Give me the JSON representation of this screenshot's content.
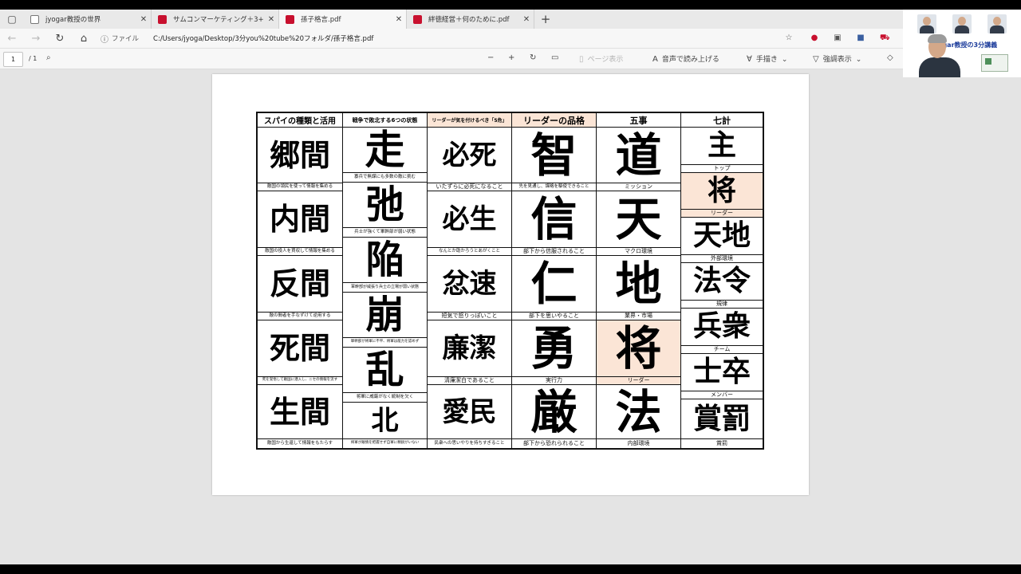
{
  "tabs": [
    {
      "label": "jyogar教授の世界",
      "icon": "page-icon",
      "active": false
    },
    {
      "label": "サムコンマーケティング＋3+4+7.pdf",
      "icon": "pdf-icon",
      "active": false
    },
    {
      "label": "孫子格言.pdf",
      "icon": "pdf-icon",
      "active": true
    },
    {
      "label": "絆徳経営＋何のために.pdf",
      "icon": "pdf-icon",
      "active": false
    }
  ],
  "address": {
    "file_label": "ファイル",
    "url": "C:/Users/jyoga/Desktop/3分you%20tube%20フォルダ/孫子格言.pdf"
  },
  "pdf_toolbar": {
    "page_current": "1",
    "page_total": "/ 1",
    "page_view": "ページ表示",
    "read_aloud": "音声で読み上げる",
    "draw": "手描き",
    "highlight": "強調表示"
  },
  "webcam": {
    "title": "jyogar教授の3分講義"
  },
  "accent": {
    "shade": "#fbe5d6",
    "pdf_red": "#c8102e"
  },
  "table": {
    "spy": {
      "header": "スパイの種類と活用",
      "items": [
        {
          "kanji": "郷間",
          "desc": "敵国の領民を使って情報を集める"
        },
        {
          "kanji": "内間",
          "desc": "敵国の役人を買収して情報を集める"
        },
        {
          "kanji": "反間",
          "desc": "敵の間者を手なずけて逆用する"
        },
        {
          "kanji": "死間",
          "desc": "死を覚悟して敵国に潜入し、ニセの情報を流す"
        },
        {
          "kanji": "生間",
          "desc": "敵国から生還して情報をもたらす"
        }
      ]
    },
    "defeat": {
      "header": "戦争で敗北する6つの状態",
      "items": [
        {
          "kanji": "走",
          "desc": "寡兵で無謀にも多数の敵に挑む"
        },
        {
          "kanji": "弛",
          "desc": "兵士が強くて軍幹部が弱い状態"
        },
        {
          "kanji": "陥",
          "desc": "軍幹部が威張り兵士の立場が弱い状態"
        },
        {
          "kanji": "崩",
          "desc": "軍幹部が将軍に不平、将軍は能力を認めず"
        },
        {
          "kanji": "乱",
          "desc": "将軍に威厳がなく統制を欠く"
        },
        {
          "kanji": "北",
          "desc": "将軍が敵情を把握せず自軍に精鋭がいない"
        }
      ]
    },
    "caution": {
      "header": "リーダーが気を付けるべき「5危」",
      "items": [
        {
          "kanji": "必死",
          "desc": "いたずらに必死になること"
        },
        {
          "kanji": "必生",
          "desc": "なんとか助かろうとあがくこと"
        },
        {
          "kanji": "忿速",
          "desc": "短気で怒りっぽいこと"
        },
        {
          "kanji": "廉潔",
          "desc": "清廉潔白であること"
        },
        {
          "kanji": "愛民",
          "desc": "民衆への思いやりを持ちすぎること"
        }
      ]
    },
    "leader": {
      "header": "リーダーの品格",
      "items": [
        {
          "kanji": "智",
          "desc": "先を見通し、謀略を駆使できること"
        },
        {
          "kanji": "信",
          "desc": "部下から信服されること"
        },
        {
          "kanji": "仁",
          "desc": "部下を思いやること"
        },
        {
          "kanji": "勇",
          "desc": "実行力"
        },
        {
          "kanji": "厳",
          "desc": "部下から恐れられること"
        }
      ]
    },
    "five": {
      "header": "五事",
      "items": [
        {
          "kanji": "道",
          "desc": "ミッション"
        },
        {
          "kanji": "天",
          "desc": "マクロ環境"
        },
        {
          "kanji": "地",
          "desc": "業界・市場"
        },
        {
          "kanji": "将",
          "desc": "リーダー"
        },
        {
          "kanji": "法",
          "desc": "内部環境"
        }
      ]
    },
    "seven": {
      "header": "七計",
      "items": [
        {
          "kanji": "主",
          "desc": "トップ"
        },
        {
          "kanji": "将",
          "desc": "リーダー"
        },
        {
          "kanji": "天地",
          "desc": "外部環境"
        },
        {
          "kanji": "法令",
          "desc": "規律"
        },
        {
          "kanji": "兵衆",
          "desc": "チーム"
        },
        {
          "kanji": "士卒",
          "desc": "メンバー"
        },
        {
          "kanji": "賞罰",
          "desc": "賞罰"
        }
      ]
    }
  }
}
